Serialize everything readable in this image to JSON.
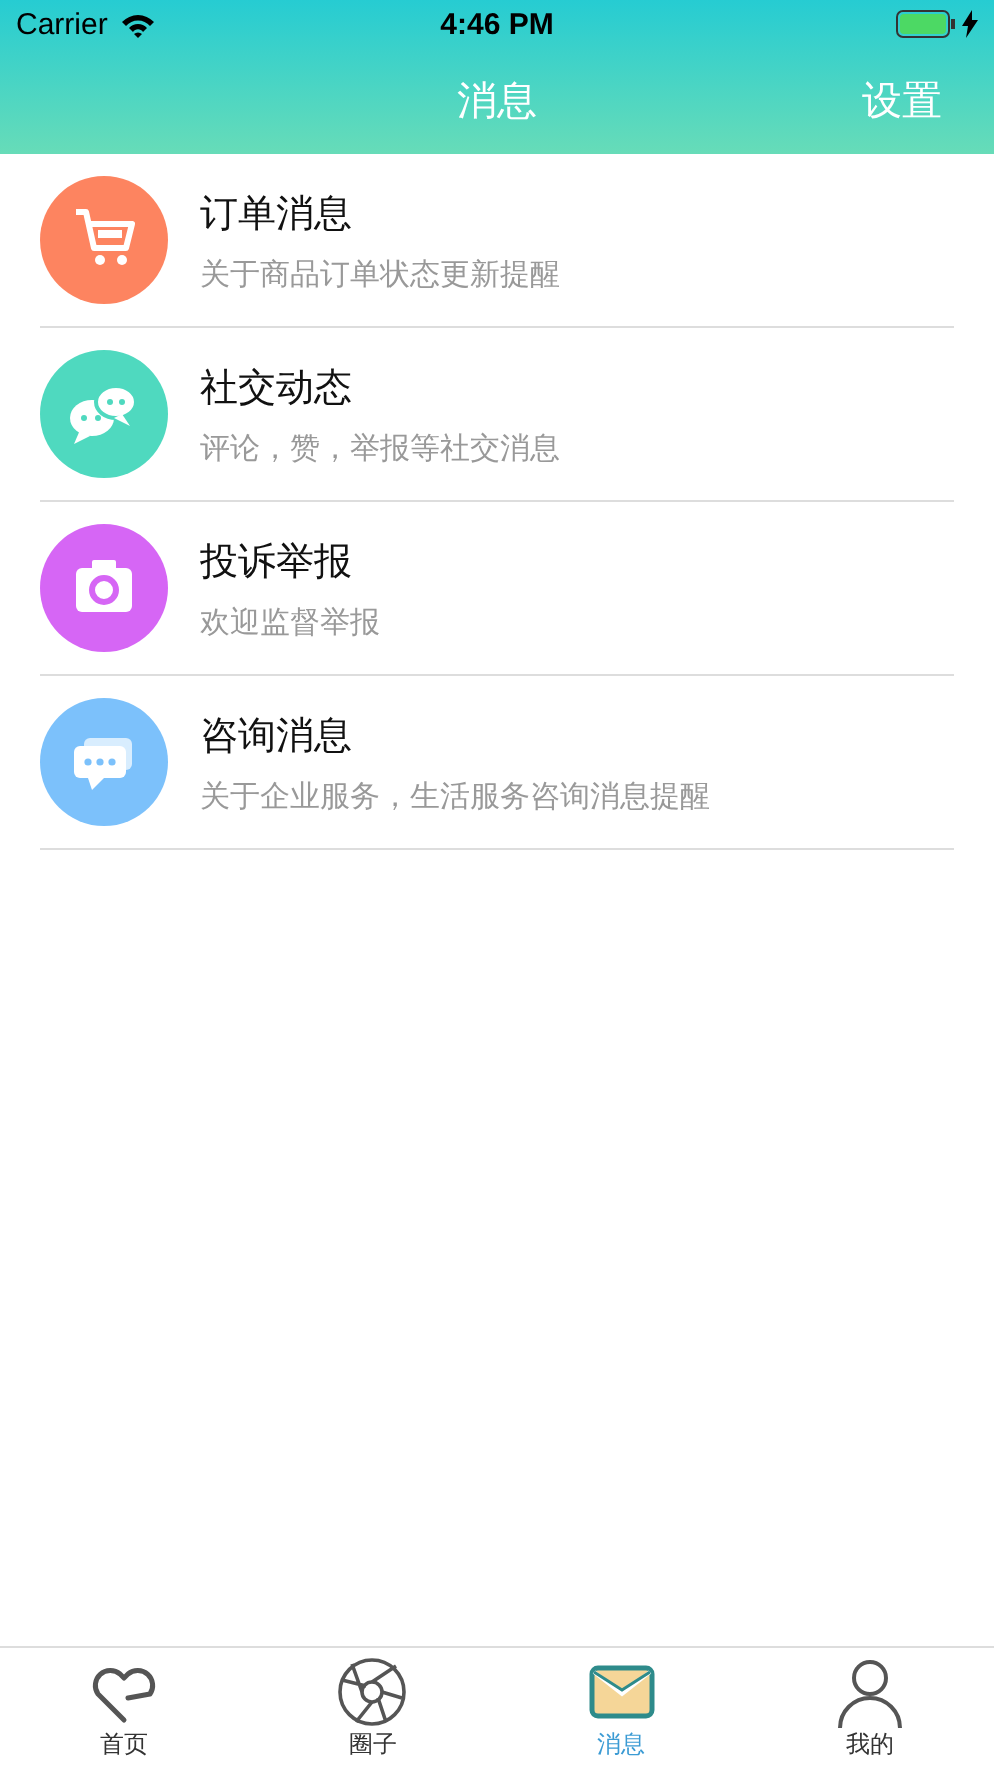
{
  "status_bar": {
    "carrier": "Carrier",
    "time": "4:46 PM"
  },
  "nav": {
    "title": "消息",
    "action": "设置"
  },
  "messages": [
    {
      "kind": "cart",
      "color": "#fd8460",
      "title": "订单消息",
      "subtitle": "关于商品订单状态更新提醒"
    },
    {
      "kind": "chat",
      "color": "#4fd9bf",
      "title": "社交动态",
      "subtitle": "评论，赞，举报等社交消息"
    },
    {
      "kind": "camera",
      "color": "#d666f5",
      "title": "投诉举报",
      "subtitle": "欢迎监督举报"
    },
    {
      "kind": "consult",
      "color": "#7cc1fb",
      "title": "咨询消息",
      "subtitle": "关于企业服务，生活服务咨询消息提醒"
    }
  ],
  "tabs": [
    {
      "kind": "heart",
      "label": "首页",
      "selected": false
    },
    {
      "kind": "aperture",
      "label": "圈子",
      "selected": false
    },
    {
      "kind": "mail",
      "label": "消息",
      "selected": true
    },
    {
      "kind": "person",
      "label": "我的",
      "selected": false
    }
  ]
}
